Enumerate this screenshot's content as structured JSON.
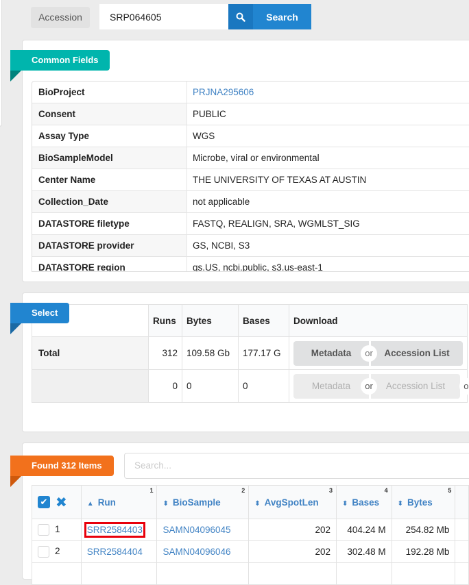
{
  "search": {
    "label": "Accession",
    "value": "SRP064605",
    "button_label": "Search",
    "icon": "search-icon"
  },
  "common_fields": {
    "title": "Common Fields",
    "rows": [
      {
        "key": "BioProject",
        "value": "PRJNA295606",
        "link": true
      },
      {
        "key": "Consent",
        "value": "PUBLIC"
      },
      {
        "key": "Assay Type",
        "value": "WGS"
      },
      {
        "key": "BioSampleModel",
        "value": "Microbe, viral or environmental"
      },
      {
        "key": "Center Name",
        "value": "THE UNIVERSITY OF TEXAS AT AUSTIN"
      },
      {
        "key": "Collection_Date",
        "value": "not applicable"
      },
      {
        "key": "DATASTORE filetype",
        "value": "FASTQ, REALIGN, SRA, WGMLST_SIG"
      },
      {
        "key": "DATASTORE provider",
        "value": "GS, NCBI, S3"
      },
      {
        "key": "DATASTORE region",
        "value": "gs.US, ncbi.public, s3.us-east-1"
      }
    ]
  },
  "select": {
    "title": "Select",
    "headers": {
      "runs": "Runs",
      "bytes": "Bytes",
      "bases": "Bases",
      "download": "Download"
    },
    "total": {
      "label": "Total",
      "runs": "312",
      "bytes": "109.58 Gb",
      "bases": "177.17 G"
    },
    "selected": {
      "label": "",
      "runs": "0",
      "bytes": "0",
      "bases": "0"
    },
    "metadata_label": "Metadata",
    "or_label": "or",
    "accession_list_label": "Accession List"
  },
  "found": {
    "title": "Found 312 Items",
    "search_placeholder": "Search...",
    "columns": [
      {
        "label": "Run",
        "num": "1",
        "sort": "▲"
      },
      {
        "label": "BioSample",
        "num": "2",
        "sort": "⇕"
      },
      {
        "label": "AvgSpotLen",
        "num": "3",
        "sort": "⇕"
      },
      {
        "label": "Bases",
        "num": "4",
        "sort": "⇕"
      },
      {
        "label": "Bytes",
        "num": "5",
        "sort": "⇕"
      }
    ],
    "rows": [
      {
        "index": "1",
        "run": "SRR2584403",
        "biosample": "SAMN04096045",
        "avgspotlen": "202",
        "bases": "404.24 M",
        "bytes": "254.82 Mb"
      },
      {
        "index": "2",
        "run": "SRR2584404",
        "biosample": "SAMN04096046",
        "avgspotlen": "202",
        "bases": "302.48 M",
        "bytes": "192.28 Mb"
      }
    ]
  }
}
